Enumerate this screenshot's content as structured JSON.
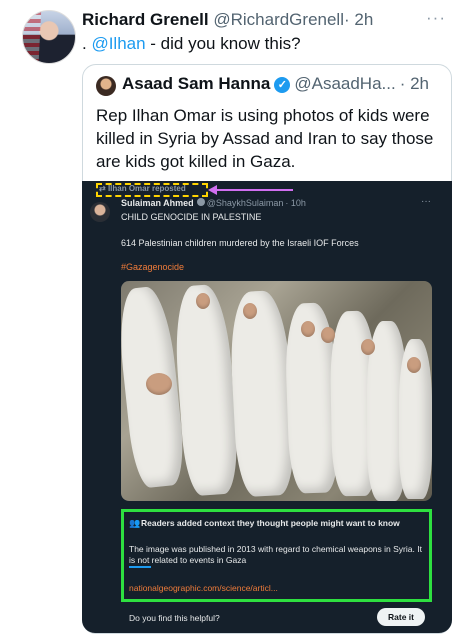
{
  "outer_tweet": {
    "display_name": "Richard Grenell",
    "handle": "@RichardGrenell",
    "time": "· 2h",
    "more": "···",
    "text_prefix": ". ",
    "mention": "@Ilhan",
    "text_suffix": " - did you know this?"
  },
  "quoted_tweet": {
    "display_name": "Asaad Sam Hanna",
    "verified_glyph": "✓",
    "handle": "@AsaadHa...",
    "time": "· 2h",
    "text": "Rep Ilhan Omar is using photos of kids were killed in Syria by Assad and Iran to say those are kids got killed in Gaza."
  },
  "embedded_post": {
    "repost_label": "Ilhan Omar reposted",
    "display_name": "Sulaiman Ahmed",
    "handle": "@ShaykhSulaiman",
    "time": "· 10h",
    "more": "···",
    "line1": "CHILD GENOCIDE IN PALESTINE",
    "line2": "614 Palestinian children murdered by the Israeli IOF Forces",
    "hashtag": "#Gazagenocide",
    "community_note": {
      "title": "Readers added context they thought people might want to know",
      "body": "The image was published in 2013 with regard to chemical weapons in Syria. It is not related to events in Gaza",
      "link": "nationalgeographic.com/science/articl..."
    },
    "helpful_prompt": "Do you find this helpful?",
    "rate_button": "Rate it"
  },
  "colors": {
    "link_blue": "#1d9bf0",
    "dark_bg": "#15202b",
    "highlight_yellow": "#ffd400",
    "highlight_green": "#2ee040",
    "arrow_purple": "#d06ff0",
    "hashtag_orange": "#f07c3a"
  },
  "icons": [
    "more-icon",
    "verified-icon",
    "repost-icon",
    "people-icon"
  ]
}
